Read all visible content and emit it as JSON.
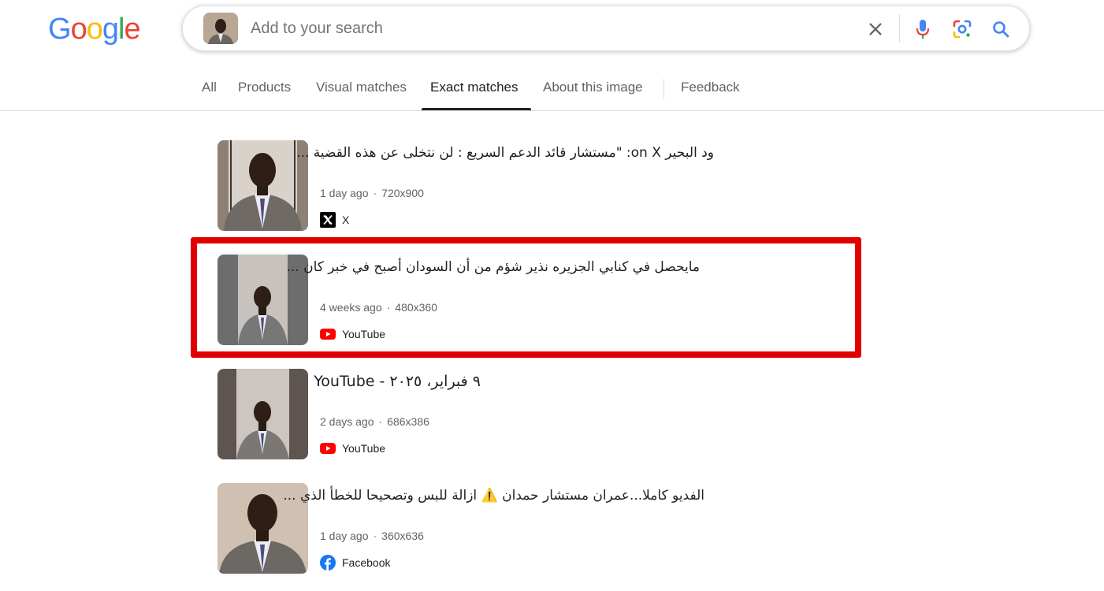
{
  "logo": {
    "letters": [
      "G",
      "o",
      "o",
      "g",
      "l",
      "e"
    ],
    "colors": [
      "#4285F4",
      "#EA4335",
      "#FBBC05",
      "#4285F4",
      "#34A853",
      "#EA4335"
    ]
  },
  "search": {
    "placeholder": "Add to your search",
    "value": ""
  },
  "tabs": [
    {
      "label": "All",
      "active": false
    },
    {
      "label": "Products",
      "active": false
    },
    {
      "label": "Visual matches",
      "active": false
    },
    {
      "label": "Exact matches",
      "active": true
    },
    {
      "label": "About this image",
      "active": false
    },
    {
      "label": "Feedback",
      "active": false
    }
  ],
  "results": [
    {
      "title": "ود البحير on X: \"مستشار قائد الدعم السريع : لن نتخلى عن هذه القضية ...",
      "age": "1 day ago",
      "size": "720x900",
      "source": "X",
      "source_icon": "x-logo-icon"
    },
    {
      "title": "مايحصل في كنابي الجزيره نذير شؤم من أن السودان أصبح في خبر كان ...",
      "age": "4 weeks ago",
      "size": "480x360",
      "source": "YouTube",
      "source_icon": "youtube-logo-icon",
      "highlighted": true
    },
    {
      "title": "٩ فبراير، ٢٠٢٥ - YouTube",
      "age": "2 days ago",
      "size": "686x386",
      "source": "YouTube",
      "source_icon": "youtube-logo-icon"
    },
    {
      "title": "الفديو كاملا...عمران مستشار حمدان ⚠️ ازالة للبس وتصحيحا للخطأ الذي ...",
      "age": "1 day ago",
      "size": "360x636",
      "source": "Facebook",
      "source_icon": "facebook-logo-icon"
    }
  ],
  "colors": {
    "highlight": "#e00000",
    "youtube": "#ff0000",
    "facebook": "#1877f2"
  }
}
